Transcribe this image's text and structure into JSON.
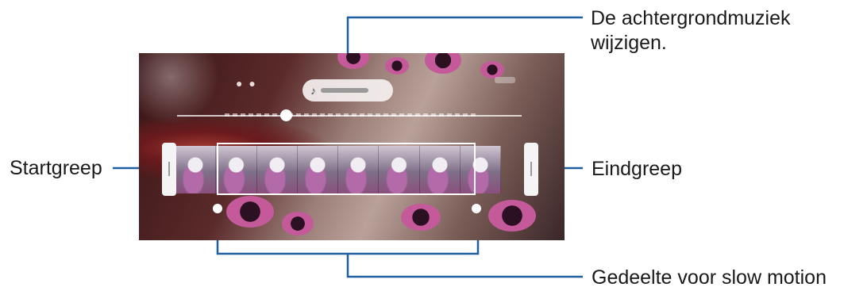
{
  "labels": {
    "music": "De achtergrondmuziek wijzigen.",
    "start_handle": "Startgreep",
    "end_handle": "Eindgreep",
    "slow_motion_section": "Gedeelte voor slow motion"
  },
  "icons": {
    "music_note": "♪"
  },
  "colors": {
    "callout_line": "#1f5fa0",
    "label_text": "#1a1a1a"
  }
}
